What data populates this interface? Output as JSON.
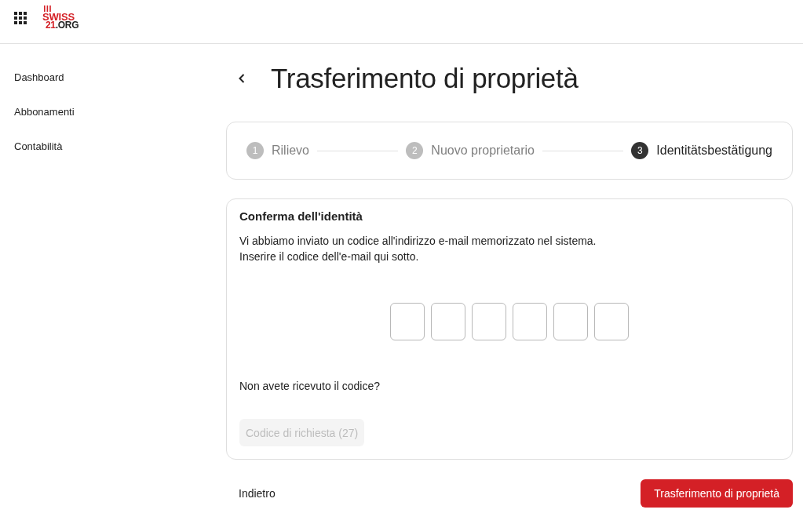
{
  "header": {
    "logo": {
      "top": "SWISS",
      "accent": "21",
      "rest": ".ORG"
    }
  },
  "sidebar": {
    "items": [
      {
        "label": "Dashboard",
        "selected": false
      },
      {
        "label": "Abbonamenti",
        "selected": false
      },
      {
        "label": "Contabilità",
        "selected": false
      }
    ]
  },
  "page": {
    "title": "Trasferimento di proprietà"
  },
  "stepper": {
    "steps": [
      {
        "number": "1",
        "label": "Rilievo",
        "selected": false
      },
      {
        "number": "2",
        "label": "Nuovo proprietario",
        "selected": false
      },
      {
        "number": "3",
        "label": "Identitätsbestätigung",
        "selected": true
      }
    ]
  },
  "identity_card": {
    "title": "Conferma dell'identità",
    "lines": [
      "Vi abbiamo inviato un codice all'indirizzo e-mail memorizzato nel sistema.",
      "Inserire il codice dell'e-mail qui sotto."
    ],
    "code_fields": [
      {
        "focused": false
      },
      {
        "focused": false
      },
      {
        "focused": false
      },
      {
        "focused": false
      },
      {
        "focused": false
      },
      {
        "focused": false
      }
    ],
    "resend_prompt": "Non avete ricevuto il codice?",
    "resend_button": {
      "label": "Codice di richiesta (27)",
      "disabled": true
    }
  },
  "footer": {
    "back_button": {
      "label": "Indietro"
    },
    "submit_button": {
      "label": "Trasferimento di proprietà",
      "disabled": false
    }
  }
}
